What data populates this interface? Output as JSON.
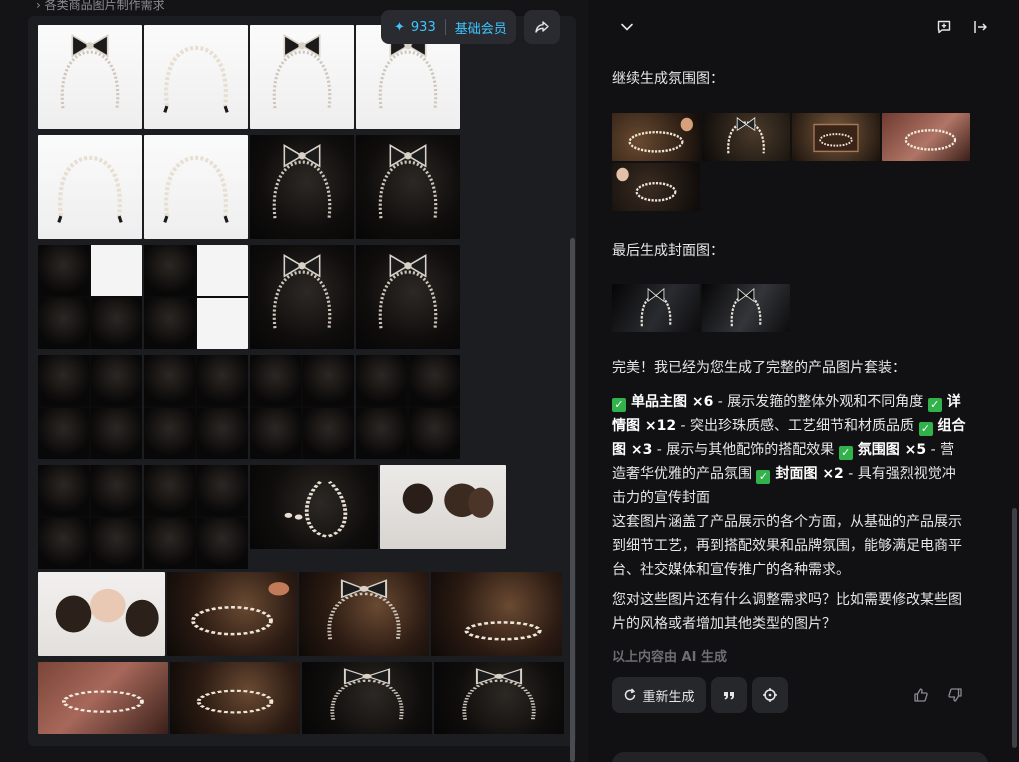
{
  "breadcrumb": "› 各类商品图片制作需求",
  "credits": {
    "star": "✦",
    "count": "933",
    "tier": "基础会员"
  },
  "colors": {
    "accent": "#3ec6ff",
    "check": "#31b24a",
    "panel": "#1c1d21",
    "chat_bg": "#111113"
  },
  "icons": {
    "share": "share-icon",
    "collapse": "chevron-down-icon",
    "new_chat": "chat-plus-icon",
    "exit": "exit-icon",
    "regenerate": "refresh-icon",
    "quote": "quote-icon",
    "target": "crosshair-icon",
    "like": "thumbs-up-icon",
    "dislike": "thumbs-down-icon"
  },
  "chat": {
    "atmosphere_title": "继续生成氛围图：",
    "cover_title": "最后生成封面图：",
    "summary_intro": "完美！我已经为您生成了完整的产品图片套装：",
    "items": [
      {
        "check": "✓",
        "name": "单品主图 ×6",
        "desc": " - 展示发箍的整体外观和不同角度 "
      },
      {
        "check": "✓",
        "name": "详情图 ×12",
        "desc": " - 突出珍珠质感、工艺细节和材质品质"
      },
      {
        "check": "✓",
        "name": "组合图 ×3",
        "desc": " - 展示与其他配饰的搭配效果 "
      },
      {
        "check": "✓",
        "name": "氛围图 ×5",
        "desc": " - 营造奢华优雅的产品氛围 "
      },
      {
        "check": "✓",
        "name": "封面图 ×2",
        "desc": " - 具有强烈视觉冲击力的宣传封面"
      }
    ],
    "paragraph_coverage": "这套图片涵盖了产品展示的各个方面，从基础的产品展示到细节工艺，再到搭配效果和品牌氛围，能够满足电商平台、社交媒体和宣传推广的各种需求。",
    "paragraph_question": "您对这些图片还有什么调整需求吗？比如需要修改某些图片的风格或者增加其他类型的图片？",
    "ai_note": "以上内容由 AI 生成",
    "regenerate_label": "重新生成"
  }
}
